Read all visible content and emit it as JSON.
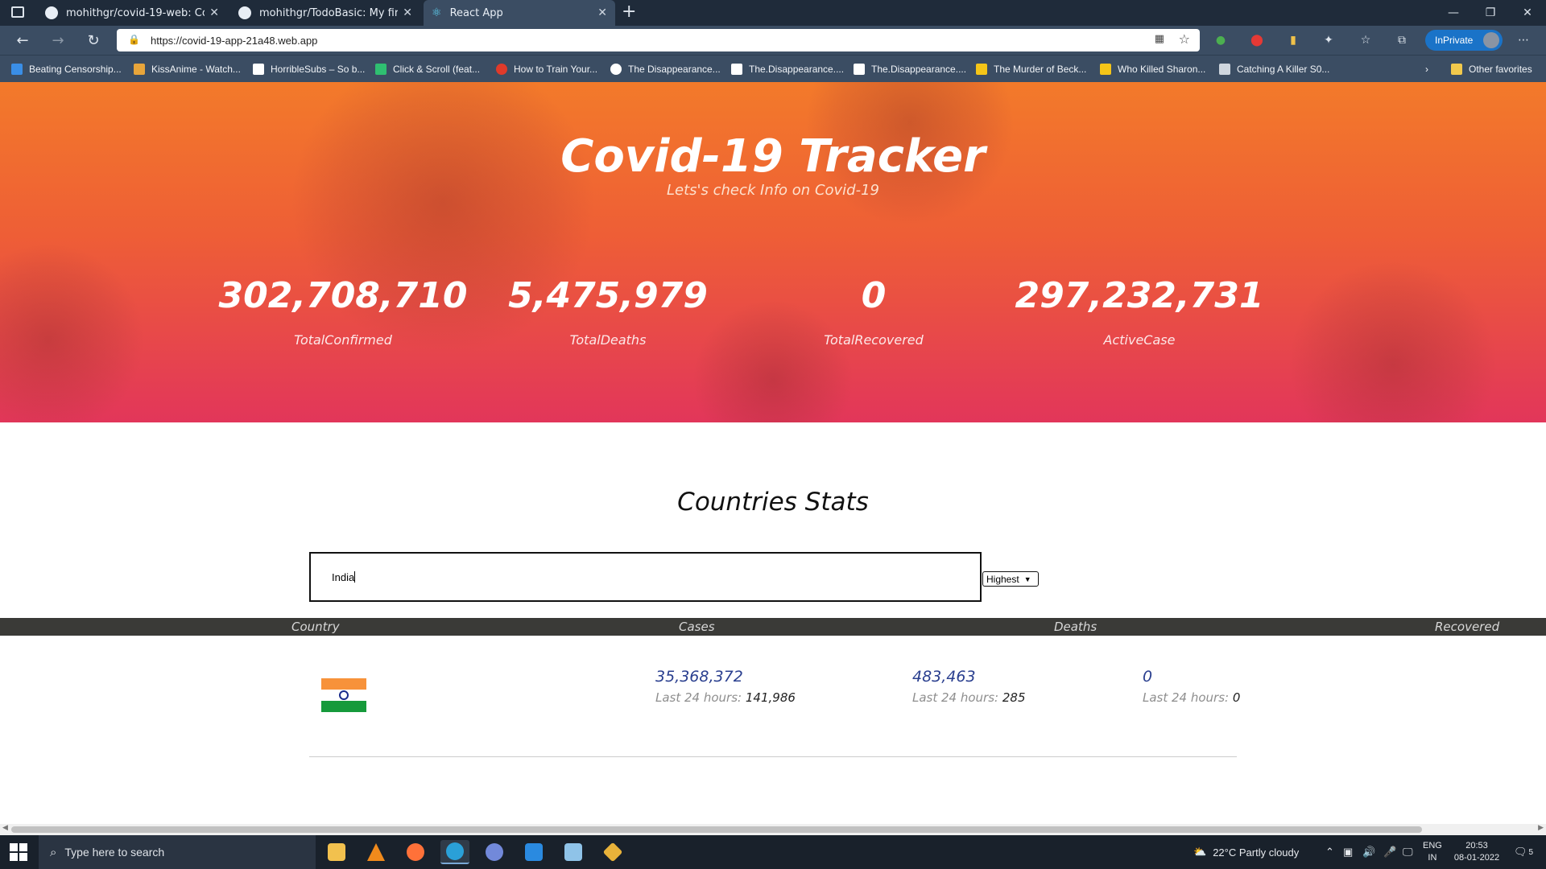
{
  "browser": {
    "tabs": [
      {
        "title": "mohithgr/covid-19-web: Covid-1",
        "icon": "github-icon"
      },
      {
        "title": "mohithgr/TodoBasic: My first Re",
        "icon": "github-icon"
      },
      {
        "title": "React App",
        "icon": "react-icon",
        "active": true
      }
    ],
    "new_tab": "+",
    "url": "https://covid-19-app-21a48.web.app",
    "inprivate_label": "InPrivate",
    "favorites": [
      {
        "label": "Beating Censorship...",
        "color": "#3a8ee6"
      },
      {
        "label": "KissAnime - Watch...",
        "color": "#e8a53a"
      },
      {
        "label": "HorribleSubs – So b...",
        "color": "#ffffff"
      },
      {
        "label": "Click & Scroll (feat...",
        "color": "#2fbf71"
      },
      {
        "label": "How to Train Your...",
        "color": "#e03a2a"
      },
      {
        "label": "The Disappearance...",
        "color": "#ffffff"
      },
      {
        "label": "The.Disappearance....",
        "color": "#ffffff"
      },
      {
        "label": "The.Disappearance....",
        "color": "#ffffff"
      },
      {
        "label": "The Murder of Beck...",
        "color": "#f5c518"
      },
      {
        "label": "Who Killed Sharon...",
        "color": "#f5c518"
      },
      {
        "label": "Catching A Killer S0...",
        "color": "#cfd6de"
      }
    ],
    "other_favorites": "Other favorites"
  },
  "hero": {
    "title": "Covid-19 Tracker",
    "subtitle": "Lets's check Info on Covid-19",
    "stats": [
      {
        "value": "302,708,710",
        "label": "TotalConfirmed"
      },
      {
        "value": "5,475,979",
        "label": "TotalDeaths"
      },
      {
        "value": "0",
        "label": "TotalRecovered"
      },
      {
        "value": "297,232,731",
        "label": "ActiveCase"
      }
    ]
  },
  "countries": {
    "title": "Countries Stats",
    "search_value": "India",
    "sort_selected": "Highest",
    "headers": [
      "Country",
      "Cases",
      "Deaths",
      "Recovered"
    ],
    "rows": [
      {
        "country_flag": "india-flag",
        "cases": "35,368,372",
        "cases_24h_label": "Last 24 hours:",
        "cases_24h": "141,986",
        "deaths": "483,463",
        "deaths_24h_label": "Last 24 hours:",
        "deaths_24h": "285",
        "recovered": "0",
        "recovered_24h_label": "Last 24 hours:",
        "recovered_24h": "0"
      }
    ]
  },
  "taskbar": {
    "search_placeholder": "Type here to search",
    "weather": "22°C  Partly cloudy",
    "lang": "ENG",
    "region": "IN",
    "time": "20:53",
    "date": "08-01-2022",
    "notifications": "5"
  }
}
